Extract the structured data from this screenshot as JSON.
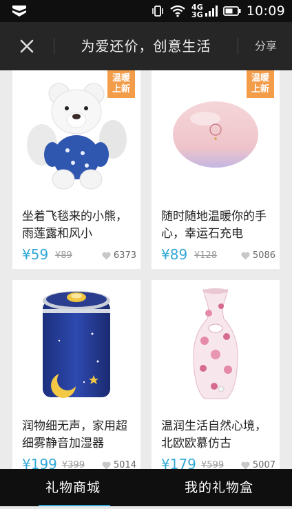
{
  "status_bar": {
    "net_top": "4G",
    "net_bottom": "3G",
    "time": "10:09",
    "icons": [
      "notification-shield-icon",
      "vibrate-icon",
      "wifi-icon",
      "signal-icon",
      "battery-icon"
    ]
  },
  "header": {
    "title": "为爱还价，创意生活",
    "share_label": "分享",
    "close_icon": "close-icon"
  },
  "products": [
    {
      "badge": [
        "温暖",
        "上新"
      ],
      "title": "坐着飞毯来的小熊，雨莲露和风小",
      "price": "¥59",
      "old_price": "¥89",
      "likes": "6373",
      "image": "teddy-bear-image"
    },
    {
      "badge": [
        "温暖",
        "上新"
      ],
      "title": "随时随地温暖你的手心，幸运石充电",
      "price": "¥89",
      "old_price": "¥128",
      "likes": "5086",
      "image": "pink-stone-warmer-image"
    },
    {
      "badge": [],
      "title": "润物细无声，家用超细雾静音加湿器",
      "price": "¥199",
      "old_price": "¥399",
      "likes": "5014",
      "image": "blue-humidifier-image"
    },
    {
      "badge": [],
      "title": "温润生活自然心境，北欧欧慕仿古",
      "price": "¥179",
      "old_price": "¥599",
      "likes": "5007",
      "image": "floral-vase-humidifier-image"
    }
  ],
  "bottom_nav": {
    "tabs": [
      {
        "label": "礼物商城",
        "active": true
      },
      {
        "label": "我的礼物盒",
        "active": false
      }
    ]
  },
  "colors": {
    "accent": "#31a8d8",
    "badge": "#f39c4a",
    "header_bg": "#262626",
    "status_bg": "#0f0f0f"
  }
}
